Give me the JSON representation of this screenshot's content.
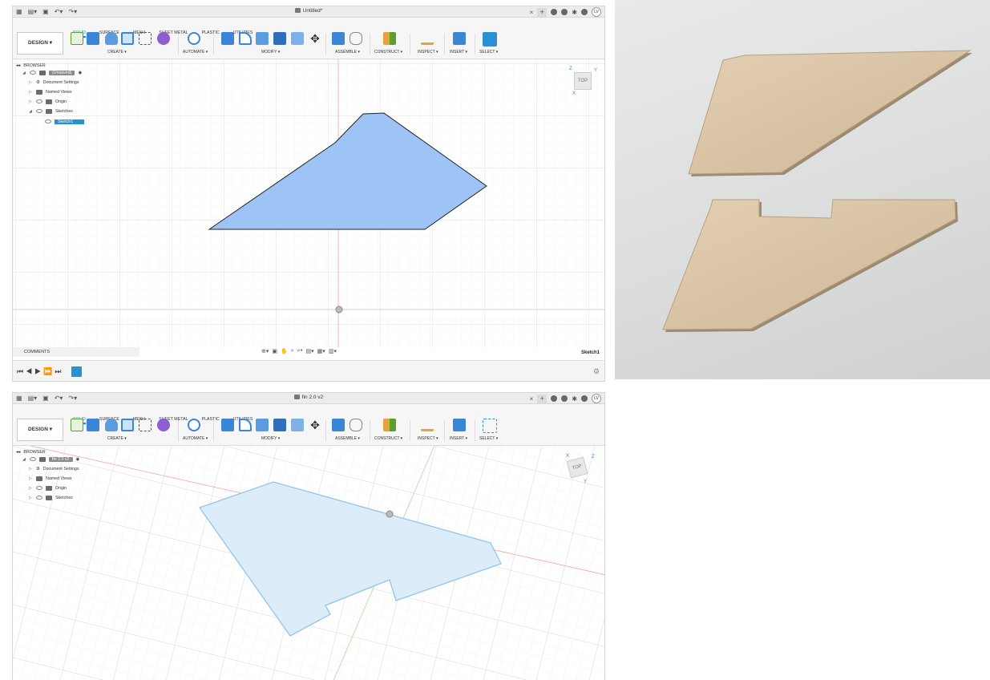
{
  "window1": {
    "title": "Untitled*",
    "tabs": [
      "SOLID",
      "SURFACE",
      "MESH",
      "SHEET METAL",
      "PLASTIC",
      "UTILITIES"
    ],
    "design_label": "DESIGN ▾",
    "groups": [
      "CREATE ▾",
      "AUTOMATE ▾",
      "MODIFY ▾",
      "ASSEMBLE ▾",
      "CONSTRUCT ▾",
      "INSPECT ▾",
      "INSERT ▾",
      "SELECT ▾"
    ],
    "browser_label": "BROWSER",
    "tree": [
      "(Unsaved)",
      "Document Settings",
      "Named Views",
      "Origin",
      "Sketches",
      "Sketch1"
    ],
    "comments_label": "COMMENTS",
    "sketch_label": "Sketch1",
    "user_initials": "LV",
    "viewcube_label": "TOP",
    "axis_labels": [
      "Z",
      "Y",
      "X"
    ]
  },
  "window2": {
    "title": "fin 2.0 v2",
    "tabs": [
      "SOLID",
      "SURFACE",
      "MESH",
      "SHEET METAL",
      "PLASTIC",
      "UTILITIES"
    ],
    "design_label": "DESIGN ▾",
    "groups": [
      "CREATE ▾",
      "AUTOMATE ▾",
      "MODIFY ▾",
      "ASSEMBLE ▾",
      "CONSTRUCT ▾",
      "INSPECT ▾",
      "INSERT ▾",
      "SELECT ▾"
    ],
    "browser_label": "BROWSER",
    "tree": [
      "fin 2.0 v2",
      "Document Settings",
      "Named Views",
      "Origin",
      "Sketches"
    ],
    "user_initials": "LV",
    "viewcube_label": "TOP",
    "axis_labels": [
      "X",
      "Z",
      "Y"
    ]
  },
  "colors": {
    "accent": "#0696d7",
    "sketch_fill": "#9ec4f5",
    "sketch_fill_2": "#dcecf8",
    "plywood": "#d8c3a5"
  }
}
